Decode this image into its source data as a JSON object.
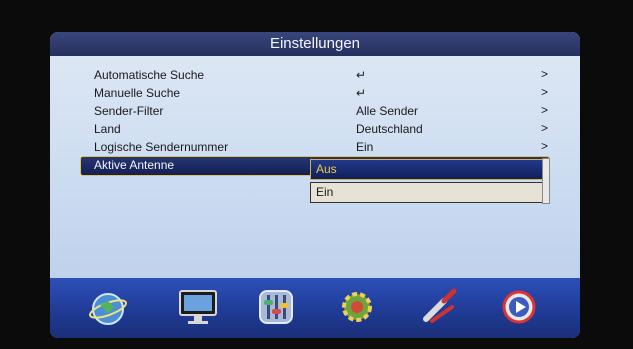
{
  "title": "Einstellungen",
  "menu": [
    {
      "label": "Automatische Suche",
      "value": "↵",
      "arrow": ">"
    },
    {
      "label": "Manuelle Suche",
      "value": "↵",
      "arrow": ">"
    },
    {
      "label": "Sender-Filter",
      "value": "Alle Sender",
      "arrow": ">"
    },
    {
      "label": "Land",
      "value": "Deutschland",
      "arrow": ">"
    },
    {
      "label": "Logische Sendernummer",
      "value": "Ein",
      "arrow": ">"
    },
    {
      "label": "Aktive Antenne",
      "value": "",
      "arrow": ""
    }
  ],
  "dropdown": {
    "options": [
      "Aus",
      "Ein"
    ],
    "selected": "Aus"
  },
  "dock_icons": [
    "globe-satellite-icon",
    "tv-monitor-icon",
    "settings-sliders-icon",
    "gear-icon",
    "antenna-plug-icon",
    "media-play-icon"
  ],
  "colors": {
    "title_bar": "#26305e",
    "highlight_border": "#e6c24a",
    "selected_text": "#f1c84a",
    "dock": "#1f3a93"
  }
}
